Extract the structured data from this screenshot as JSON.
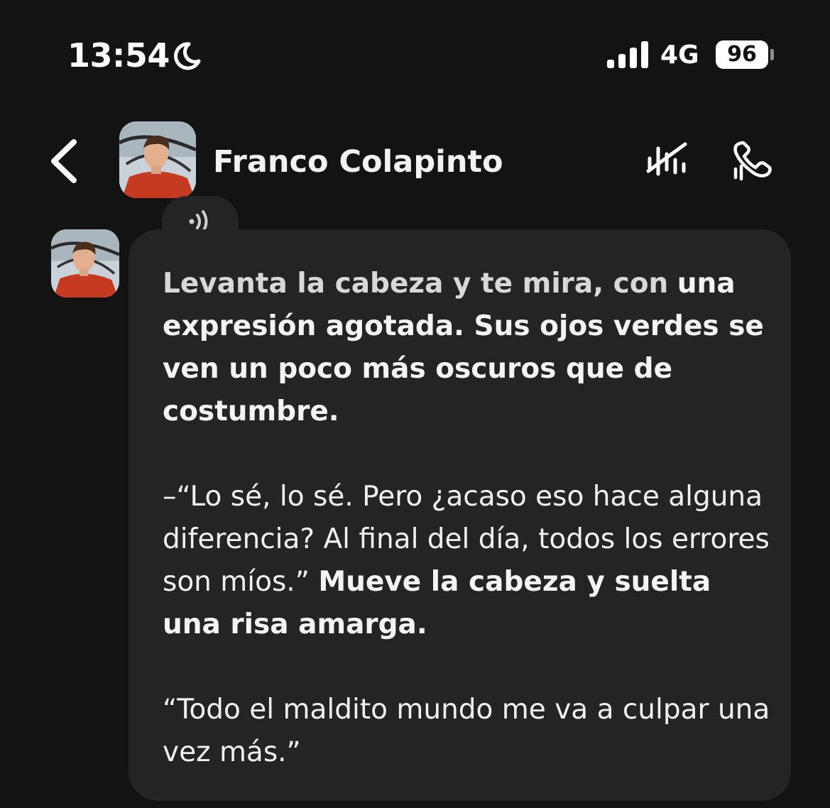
{
  "status_bar": {
    "time": "13:54",
    "moon_icon": "moon-icon",
    "signal_icon": "cellular-signal-icon",
    "network": "4G",
    "battery": "96"
  },
  "header": {
    "back_icon": "chevron-left-icon",
    "contact_name": "Franco Colapinto",
    "voice_off_icon": "voice-off-icon",
    "call_icon": "phone-call-icon"
  },
  "message": {
    "audio_icon": "speaker-wave-icon",
    "p1_line1": "Levanta la cabeza y te mira, con",
    "p1_rest": "una expresión agotada. Sus ojos verdes se ven un poco más oscuros que de costumbre.",
    "p2_speech": "–“Lo sé, lo sé. Pero ¿acaso eso hace alguna diferencia? Al final del día, todos los errores son míos.”",
    "p2_action": "Mueve la cabeza y suelta una risa amarga.",
    "p3_speech": "“Todo el maldito mundo me va a culpar una vez más.”"
  },
  "colors": {
    "background": "#131313",
    "bubble": "#242424",
    "text": "#f0f0f0"
  }
}
